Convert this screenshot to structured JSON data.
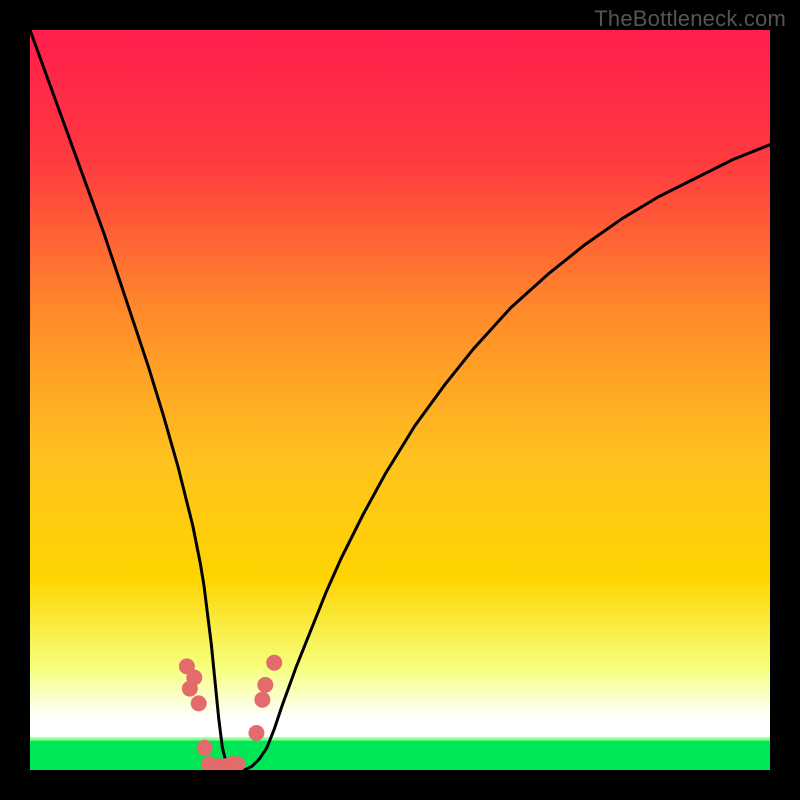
{
  "watermark": "TheBottleneck.com",
  "colors": {
    "frame": "#000000",
    "curve": "#000000",
    "marker": "#e46b6b",
    "band": "#00e756",
    "gradient_top": "#ff1e4c",
    "gradient_mid": "#ffd400",
    "gradient_low": "#f6ff7a",
    "gradient_bottom": "#ffffff"
  },
  "chart_data": {
    "type": "line",
    "title": "",
    "xlabel": "",
    "ylabel": "",
    "xlim": [
      0,
      100
    ],
    "ylim": [
      0,
      100
    ],
    "curve_x": [
      0,
      2,
      4,
      6,
      8,
      10,
      12,
      14,
      16,
      18,
      20,
      21,
      22,
      23,
      23.5,
      24,
      24.5,
      25,
      25.5,
      26,
      26.5,
      27,
      28,
      29,
      30,
      31,
      32,
      33,
      34,
      36,
      38,
      40,
      42,
      45,
      48,
      52,
      56,
      60,
      65,
      70,
      75,
      80,
      85,
      90,
      95,
      100
    ],
    "curve_y": [
      100,
      94.5,
      89,
      83.5,
      78,
      72.5,
      66.5,
      60.5,
      54.5,
      48,
      41,
      37,
      33,
      28,
      25,
      21,
      17,
      12,
      7,
      3,
      1,
      0,
      0,
      0,
      0.5,
      1.5,
      3,
      5.5,
      8.5,
      14,
      19,
      24,
      28.5,
      34.5,
      40,
      46.5,
      52,
      57,
      62.5,
      67,
      71,
      74.5,
      77.5,
      80,
      82.5,
      84.5
    ],
    "green_band_y": [
      0,
      4
    ],
    "markers": [
      {
        "x": 21.2,
        "y": 14.0
      },
      {
        "x": 21.6,
        "y": 11.0
      },
      {
        "x": 22.2,
        "y": 12.5
      },
      {
        "x": 22.8,
        "y": 9.0
      },
      {
        "x": 23.6,
        "y": 3.0
      },
      {
        "x": 24.2,
        "y": 0.8
      },
      {
        "x": 24.8,
        "y": 0.5
      },
      {
        "x": 25.6,
        "y": 0.5
      },
      {
        "x": 26.4,
        "y": 0.5
      },
      {
        "x": 27.2,
        "y": 0.8
      },
      {
        "x": 28.0,
        "y": 0.8
      },
      {
        "x": 30.6,
        "y": 5.0
      },
      {
        "x": 31.4,
        "y": 9.5
      },
      {
        "x": 31.8,
        "y": 11.5
      },
      {
        "x": 33.0,
        "y": 14.5
      }
    ]
  }
}
